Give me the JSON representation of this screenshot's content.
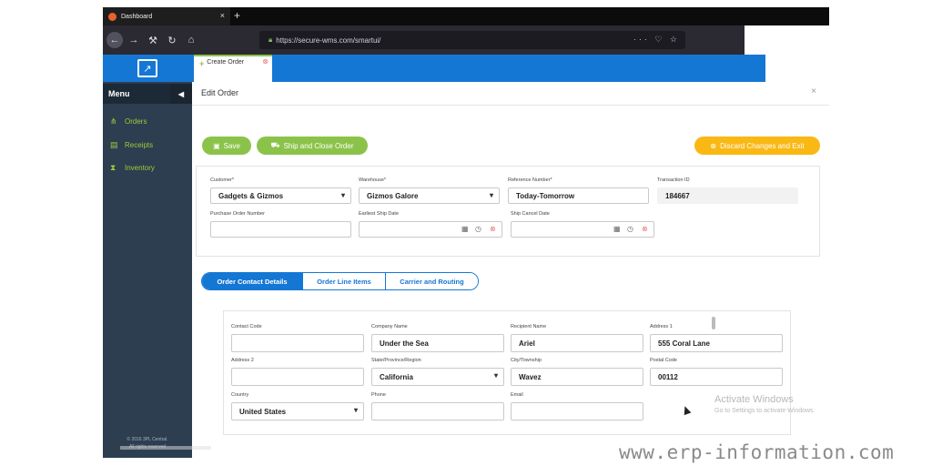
{
  "browser": {
    "tab_title": "Dashboard",
    "tab_close": "×",
    "new_tab": "+",
    "url": "https://secure-wms.com/smartui/",
    "url_actions": "··· ♡ ☆"
  },
  "app": {
    "tab_label": "Create Order",
    "tab_close": "⊗",
    "menu_title": "Menu",
    "menu_collapse": "◀",
    "sidebar": [
      {
        "icon": "sitemap-icon",
        "glyph": "⋔",
        "label": "Orders"
      },
      {
        "icon": "document-icon",
        "glyph": "▤",
        "label": "Receipts"
      },
      {
        "icon": "hourglass-icon",
        "glyph": "⧗",
        "label": "Inventory"
      }
    ],
    "copyright_1": "© 2016 3PL Central.",
    "copyright_2": "All rights reserved"
  },
  "edit_order": {
    "title": "Edit Order",
    "close": "×",
    "save_label": "Save",
    "ship_close_label": "Ship and Close Order",
    "discard_label": "Discard Changes and Exit",
    "customer_label": "Customer*",
    "customer_value": "Gadgets & Gizmos",
    "warehouse_label": "Warehouse*",
    "warehouse_value": "Gizmos Galore",
    "reference_label": "Reference Number*",
    "reference_value": "Today-Tomorrow",
    "transaction_label": "Transaction ID",
    "transaction_value": "184667",
    "po_label": "Purchase Order Number",
    "po_value": "",
    "earliest_ship_label": "Earliest Ship Date",
    "earliest_ship_value": "",
    "ship_cancel_label": "Ship Cancel Date",
    "ship_cancel_value": ""
  },
  "tabs": [
    "Order Contact Details",
    "Order Line Items",
    "Carrier and Routing"
  ],
  "contact": {
    "contact_code_label": "Contact Code",
    "contact_code_value": "",
    "company_label": "Company Name",
    "company_value": "Under the Sea",
    "recipient_label": "Recipient Name",
    "recipient_value": "Ariel",
    "address1_label": "Address 1",
    "address1_value": "555 Coral Lane",
    "address2_label": "Address 2",
    "address2_value": "",
    "state_label": "State/Province/Region",
    "state_value": "California",
    "city_label": "City/Township",
    "city_value": "Wavez",
    "postal_label": "Postal Code",
    "postal_value": "00112",
    "country_label": "Country",
    "country_value": "United States",
    "phone_label": "Phone",
    "phone_value": "",
    "email_label": "Email",
    "email_value": ""
  },
  "overlay": {
    "activate_title": "Activate Windows",
    "activate_sub": "Go to Settings to activate Windows.",
    "watermark": "www.erp-information.com"
  }
}
